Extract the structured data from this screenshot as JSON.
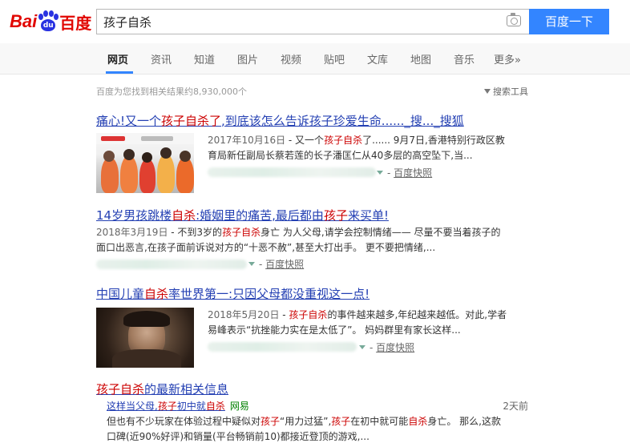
{
  "logo": {
    "text_left": "Bai",
    "text_paw": "du",
    "text_right": "百度"
  },
  "search": {
    "query": "孩子自杀",
    "button_label": "百度一下"
  },
  "tabs": [
    {
      "label": "网页"
    },
    {
      "label": "资讯"
    },
    {
      "label": "知道"
    },
    {
      "label": "图片"
    },
    {
      "label": "视频"
    },
    {
      "label": "贴吧"
    },
    {
      "label": "文库"
    },
    {
      "label": "地图"
    },
    {
      "label": "音乐"
    },
    {
      "label": "更多»"
    }
  ],
  "results_info": "百度为您找到相关结果约8,930,000个",
  "search_tools": "搜索工具",
  "results": [
    {
      "title_parts": [
        "痛心!又一个",
        "孩子自杀了",
        ",到底该怎么告诉孩子珍爱生命......_搜..._搜狐"
      ],
      "date": "2017年10月16日",
      "abstract_1a": " - 又一个",
      "abstract_1b": "孩子自杀",
      "abstract_1c": "了...... 9月7日,香港特别行政区教",
      "abstract_2": "育局新任副局长蔡若莲的长子潘匡仁从40多层的高空坠下,当...",
      "snapshot": "百度快照"
    },
    {
      "title_parts": [
        "14岁男孩跳楼",
        "自杀",
        ":婚姻里的痛苦,最后都由",
        "孩子",
        "来买单!"
      ],
      "date": "2018年3月19日",
      "abstract_1a": " - 不到3岁的",
      "abstract_1b": "孩子自杀",
      "abstract_1c": "身亡 为人父母,请学会控制情绪—— 尽量不要当着孩子的",
      "abstract_2": "面口出恶言,在孩子面前诉说对方的“十恶不赦”,甚至大打出手。 更不要把情绪,...",
      "snapshot": "百度快照"
    },
    {
      "title_parts": [
        "中国儿童",
        "自杀",
        "率世界第一:只因父母都没重视这一点!"
      ],
      "date": "2018年5月20日",
      "abstract_1a": " - ",
      "abstract_1b": "孩子自杀",
      "abstract_1c": "的事件越来越多,年纪越来越低。对此,学者",
      "abstract_2": "易峰表示“抗挫能力实在是太低了”。 妈妈群里有家长这样...",
      "snapshot": "百度快照"
    }
  ],
  "news": {
    "title_highlight": "孩子自杀",
    "title_rest": "的最新相关信息",
    "item_parts": [
      "这样当父母,",
      "孩子",
      "初中就",
      "自杀"
    ],
    "item_source": "网易",
    "item_time": "2天前",
    "abstract_line1a": "但也有不少玩家在体验过程中疑似对",
    "abstract_line1b": "孩子",
    "abstract_line1c": "“用力过猛”,",
    "abstract_line1d": "孩子",
    "abstract_line1e": "在初中就可能",
    "abstract_line1f": "自杀",
    "abstract_line1g": "身亡。 那么,这款",
    "abstract_line2": "口碑(近90%好评)和销量(平台畅销前10)都接近登顶的游戏,..."
  },
  "colors": {
    "accent": "#3385ff",
    "link": "#2440b3",
    "highlight": "#cc0000",
    "logo_red": "#e10601",
    "logo_blue": "#2932e1"
  }
}
